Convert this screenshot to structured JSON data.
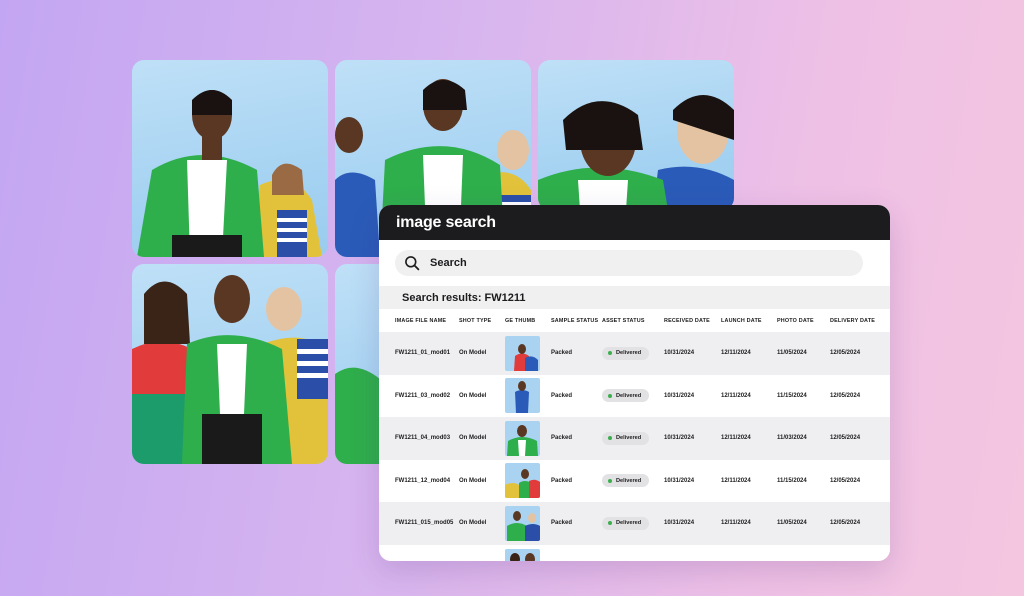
{
  "panel": {
    "title": "image search",
    "search_placeholder": "Search",
    "results_label": "Search results: FW1211"
  },
  "table": {
    "columns": [
      "IMAGE FILE NAME",
      "SHOT TYPE",
      "GE THUMB",
      "SAMPLE STATUS",
      "ASSET STATUS",
      "RECEIVED DATE",
      "LAUNCH DATE",
      "PHOTO DATE",
      "DELIVERY DATE"
    ],
    "rows": [
      {
        "file": "FW1211_01_mod01",
        "shot": "On Model",
        "sample": "Packed",
        "asset": "Delivered",
        "received": "10/31/2024",
        "launch": "12/11/2024",
        "photo": "11/05/2024",
        "delivery": "12/05/2024"
      },
      {
        "file": "FW1211_03_mod02",
        "shot": "On Model",
        "sample": "Packed",
        "asset": "Delivered",
        "received": "10/31/2024",
        "launch": "12/11/2024",
        "photo": "11/15/2024",
        "delivery": "12/05/2024"
      },
      {
        "file": "FW1211_04_mod03",
        "shot": "On Model",
        "sample": "Packed",
        "asset": "Delivered",
        "received": "10/31/2024",
        "launch": "12/11/2024",
        "photo": "11/03/2024",
        "delivery": "12/05/2024"
      },
      {
        "file": "FW1211_12_mod04",
        "shot": "On Model",
        "sample": "Packed",
        "asset": "Delivered",
        "received": "10/31/2024",
        "launch": "12/11/2024",
        "photo": "11/15/2024",
        "delivery": "12/05/2024"
      },
      {
        "file": "FW1211_015_mod05",
        "shot": "On Model",
        "sample": "Packed",
        "asset": "Delivered",
        "received": "10/31/2024",
        "launch": "12/11/2024",
        "photo": "11/05/2024",
        "delivery": "12/05/2024"
      }
    ]
  },
  "colors": {
    "header_bg": "#1c1c1e",
    "status_dot": "#3dae4e",
    "jacket_green": "#2fae4c",
    "jacket_yellow": "#e2c23a"
  }
}
